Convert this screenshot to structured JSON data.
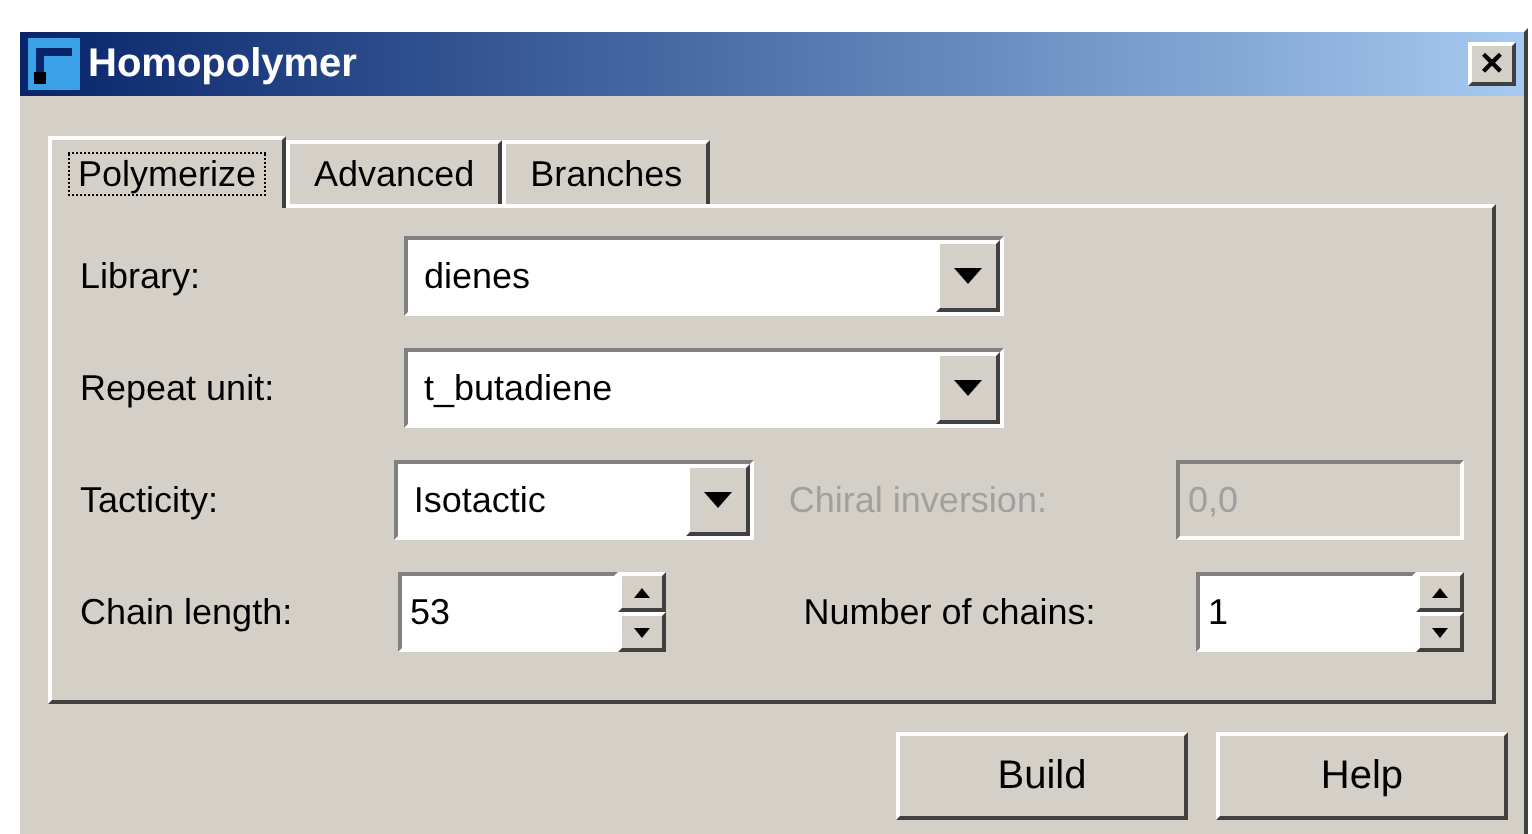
{
  "window": {
    "title": "Homopolymer",
    "close": "×"
  },
  "tabs": [
    {
      "label": "Polymerize",
      "selected": true
    },
    {
      "label": "Advanced",
      "selected": false
    },
    {
      "label": "Branches",
      "selected": false
    }
  ],
  "library": {
    "label": "Library:",
    "value": "dienes"
  },
  "repeat_unit": {
    "label": "Repeat unit:",
    "value": "t_butadiene"
  },
  "tacticity": {
    "label": "Tacticity:",
    "value": "Isotactic"
  },
  "chiral_inversion": {
    "label": "Chiral inversion:",
    "value": "0,0",
    "disabled": true
  },
  "chain_length": {
    "label": "Chain length:",
    "value": "53"
  },
  "number_of_chains": {
    "label": "Number of chains:",
    "value": "1"
  },
  "buttons": [
    "Build",
    "Help"
  ]
}
